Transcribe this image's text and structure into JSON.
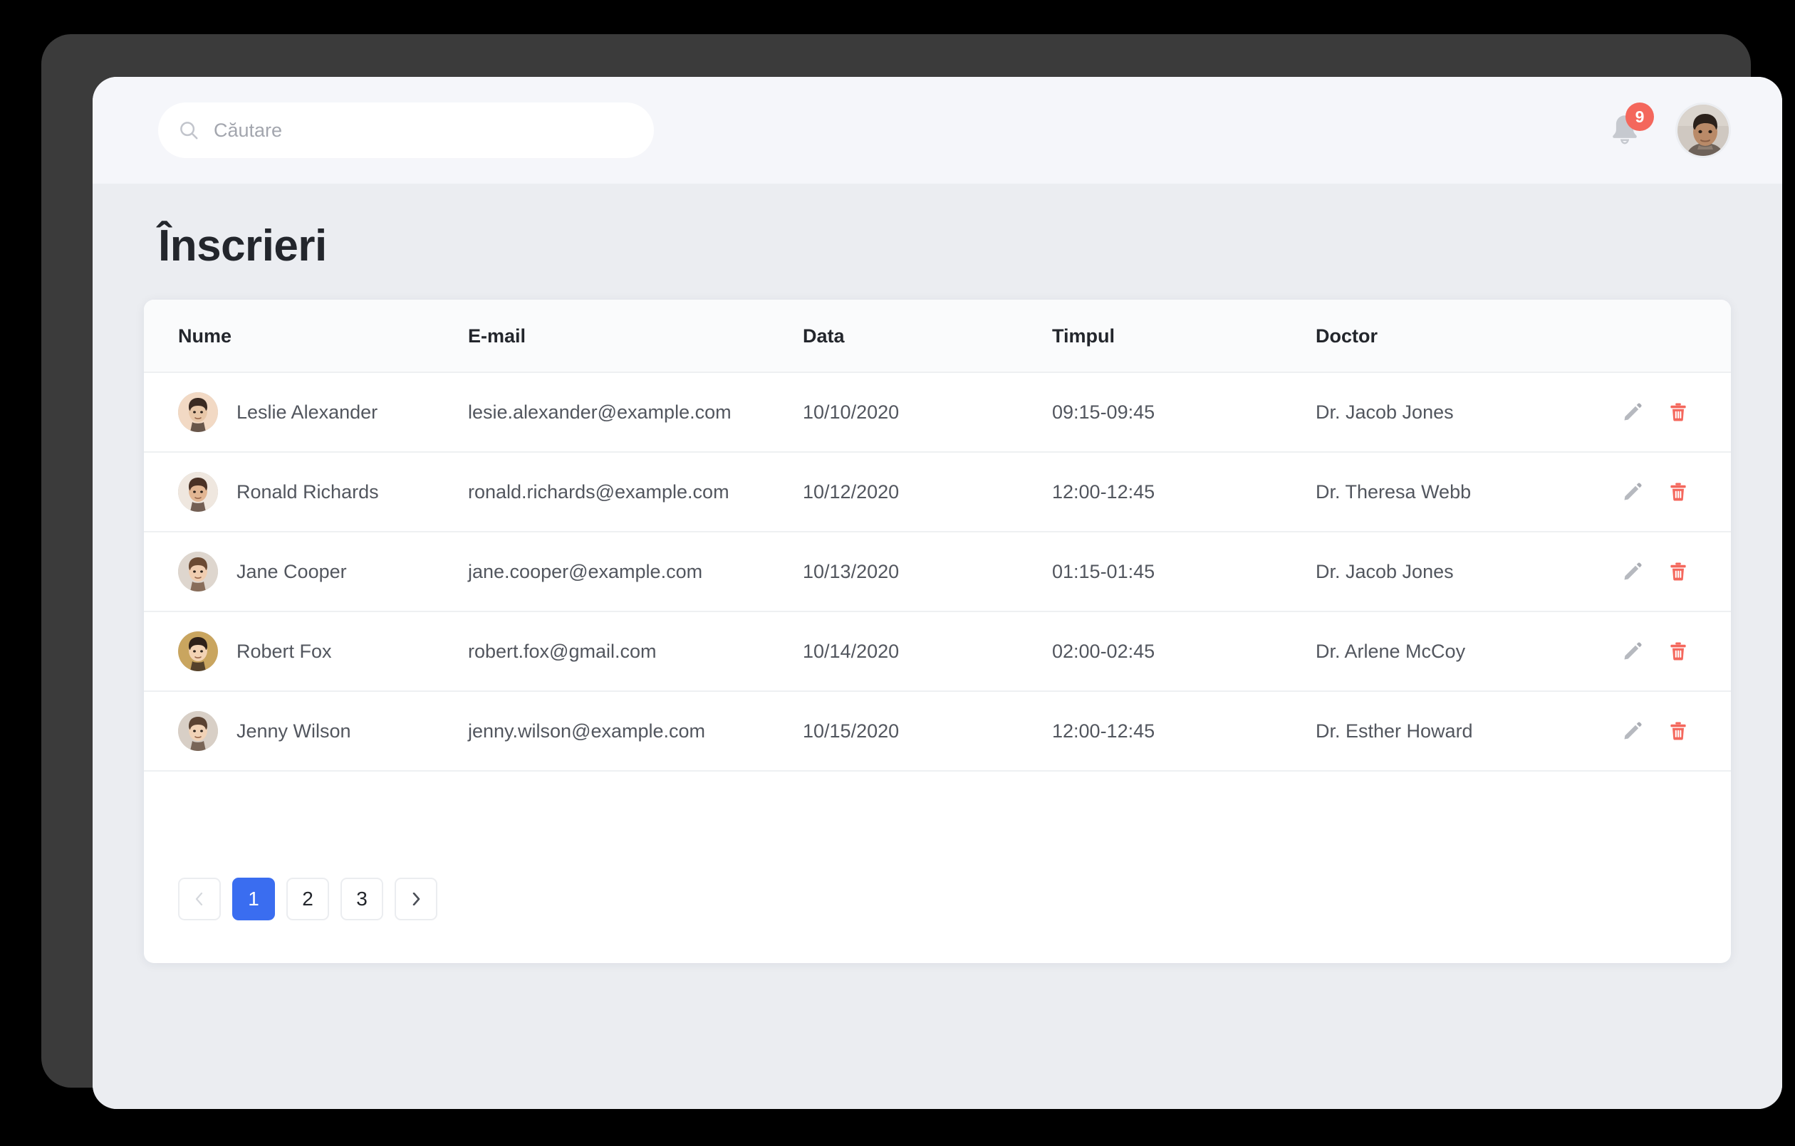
{
  "window": {
    "frame_color": "#3b3b3b",
    "body_bg": "#ebedf1",
    "topbar_bg": "#f5f6fa"
  },
  "topbar": {
    "search": {
      "placeholder": "Căutare",
      "value": "",
      "icon": "search-icon"
    },
    "notifications": {
      "icon": "bell-icon",
      "badge_count": "9",
      "badge_color": "#f4675c"
    },
    "avatar": {
      "icon": "user-avatar",
      "alt": "Account avatar"
    }
  },
  "page": {
    "title": "Înscrieri"
  },
  "table": {
    "columns": [
      {
        "key": "name",
        "label": "Nume"
      },
      {
        "key": "email",
        "label": "E-mail"
      },
      {
        "key": "date",
        "label": "Data"
      },
      {
        "key": "time",
        "label": "Timpul"
      },
      {
        "key": "doctor",
        "label": "Doctor"
      },
      {
        "key": "actions",
        "label": ""
      }
    ],
    "rows": [
      {
        "name": "Leslie Alexander",
        "email": "lesie.alexander@example.com",
        "date": "10/10/2020",
        "time": "09:15-09:45",
        "doctor": "Dr. Jacob Jones",
        "avatar_colors": [
          "#e8c7a8",
          "#3a2a22",
          "#f2d9c4"
        ]
      },
      {
        "name": "Ronald Richards",
        "email": "ronald.richards@example.com",
        "date": "10/12/2020",
        "time": "12:00-12:45",
        "doctor": "Dr. Theresa Webb",
        "avatar_colors": [
          "#e2b693",
          "#4a3226",
          "#efe7df"
        ]
      },
      {
        "name": "Jane Cooper",
        "email": "jane.cooper@example.com",
        "date": "10/13/2020",
        "time": "01:15-01:45",
        "doctor": "Dr. Jacob Jones",
        "avatar_colors": [
          "#f0cdb0",
          "#6b4a33",
          "#ded6ce"
        ]
      },
      {
        "name": "Robert Fox",
        "email": "robert.fox@gmail.com",
        "date": "10/14/2020",
        "time": "02:00-02:45",
        "doctor": "Dr. Arlene McCoy",
        "avatar_colors": [
          "#f3d3b4",
          "#2e2119",
          "#c9a55f"
        ]
      },
      {
        "name": "Jenny Wilson",
        "email": "jenny.wilson@example.com",
        "date": "10/15/2020",
        "time": "12:00-12:45",
        "doctor": "Dr. Esther Howard",
        "avatar_colors": [
          "#f1d2b6",
          "#5a4232",
          "#d8cfc6"
        ]
      }
    ],
    "row_actions": {
      "edit": {
        "icon": "pencil-icon",
        "color": "#b6b9bf",
        "label": "Edit"
      },
      "delete": {
        "icon": "trash-icon",
        "color": "#f4675c",
        "label": "Delete"
      }
    }
  },
  "pagination": {
    "prev": {
      "icon": "chevron-left-icon",
      "disabled": true
    },
    "next": {
      "icon": "chevron-right-icon",
      "disabled": false
    },
    "pages": [
      "1",
      "2",
      "3"
    ],
    "current": "1",
    "active_color": "#3a6df0"
  }
}
